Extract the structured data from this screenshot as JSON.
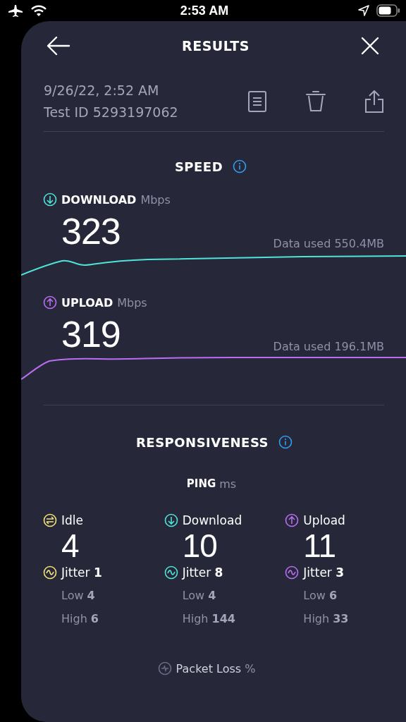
{
  "status_bar": {
    "time": "2:53 AM"
  },
  "header": {
    "title": "RESULTS"
  },
  "test": {
    "date": "9/26/22, 2:52 AM",
    "test_id": "Test ID 5293197062"
  },
  "speed": {
    "title": "SPEED",
    "metrics": [
      {
        "kind": "download",
        "label": "DOWNLOAD",
        "unit": "Mbps",
        "value": "323",
        "data_used": "Data used 550.4MB",
        "color": "#4fe3d9"
      },
      {
        "kind": "upload",
        "label": "UPLOAD",
        "unit": "Mbps",
        "value": "319",
        "data_used": "Data used 196.1MB",
        "color": "#b86ef2"
      }
    ]
  },
  "responsiveness": {
    "title": "RESPONSIVENESS",
    "ping_label": "PING",
    "ping_unit": "ms",
    "columns": [
      {
        "kind": "idle",
        "label": "Idle",
        "value": "4",
        "jitter_label": "Jitter",
        "jitter": "1",
        "low_label": "Low",
        "low": "4",
        "high_label": "High",
        "high": "6",
        "color": "#f2e27a"
      },
      {
        "kind": "download",
        "label": "Download",
        "value": "10",
        "jitter_label": "Jitter",
        "jitter": "8",
        "low_label": "Low",
        "low": "4",
        "high_label": "High",
        "high": "144",
        "color": "#4fe3d9"
      },
      {
        "kind": "upload",
        "label": "Upload",
        "value": "11",
        "jitter_label": "Jitter",
        "jitter": "3",
        "low_label": "Low",
        "low": "6",
        "high_label": "High",
        "high": "33",
        "color": "#b86ef2"
      }
    ],
    "packet_loss": {
      "label": "Packet Loss",
      "unit": "%"
    }
  }
}
